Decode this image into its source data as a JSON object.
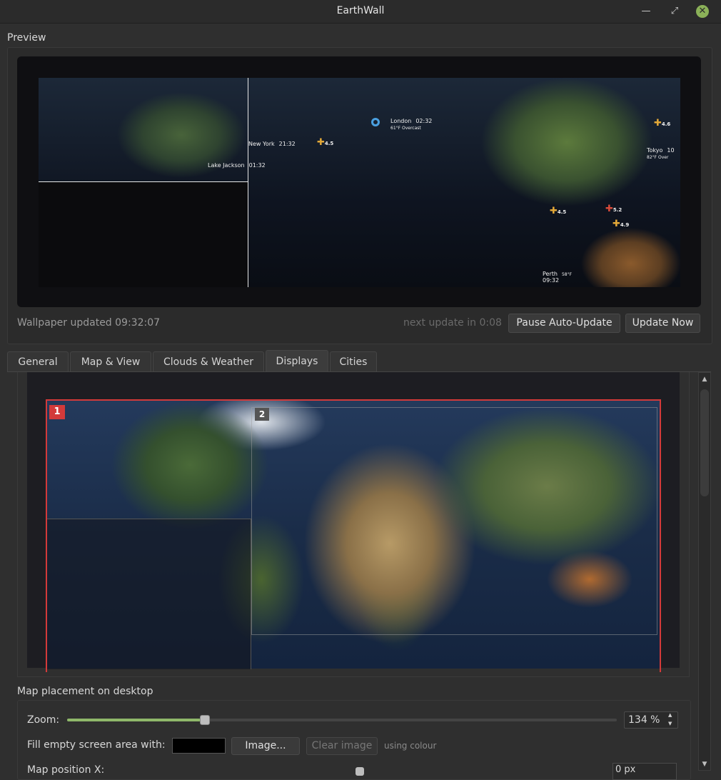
{
  "window": {
    "title": "EarthWall"
  },
  "preview": {
    "label": "Preview",
    "cities": [
      {
        "name": "London",
        "time": "02:32",
        "weather": "61°F Overcast"
      },
      {
        "name": "New York",
        "time": "21:32"
      },
      {
        "name": "Lake Jackson",
        "time": "01:32"
      },
      {
        "name": "Tokyo",
        "time": "10",
        "weather": "82°F Over"
      },
      {
        "name": "Perth",
        "time": "09:32",
        "weather": "58°F"
      }
    ],
    "quakes": [
      {
        "mag": "4.5"
      },
      {
        "mag": "4.6"
      },
      {
        "mag": "4.5"
      },
      {
        "mag": "5.2"
      },
      {
        "mag": "4.9"
      }
    ],
    "status_left": "Wallpaper updated 09:32:07",
    "status_right": "next update in 0:08",
    "pause_button": "Pause Auto-Update",
    "update_button": "Update Now"
  },
  "tabs": [
    {
      "label": "General"
    },
    {
      "label": "Map & View"
    },
    {
      "label": "Clouds & Weather"
    },
    {
      "label": "Displays",
      "active": true
    },
    {
      "label": "Cities"
    }
  ],
  "displays": {
    "badge_1": "1",
    "badge_2": "2",
    "accent_color": "#d33a3a"
  },
  "placement": {
    "label": "Map placement on desktop",
    "zoom_label": "Zoom:",
    "zoom_value": "134 %",
    "zoom_fraction": 0.25,
    "fill_label": "Fill empty screen area with:",
    "fill_colour": "#000000",
    "image_button": "Image...",
    "clear_button": "Clear image",
    "using_colour": "using colour",
    "map_position_label": "Map position X:",
    "map_position_value": "0 px"
  }
}
